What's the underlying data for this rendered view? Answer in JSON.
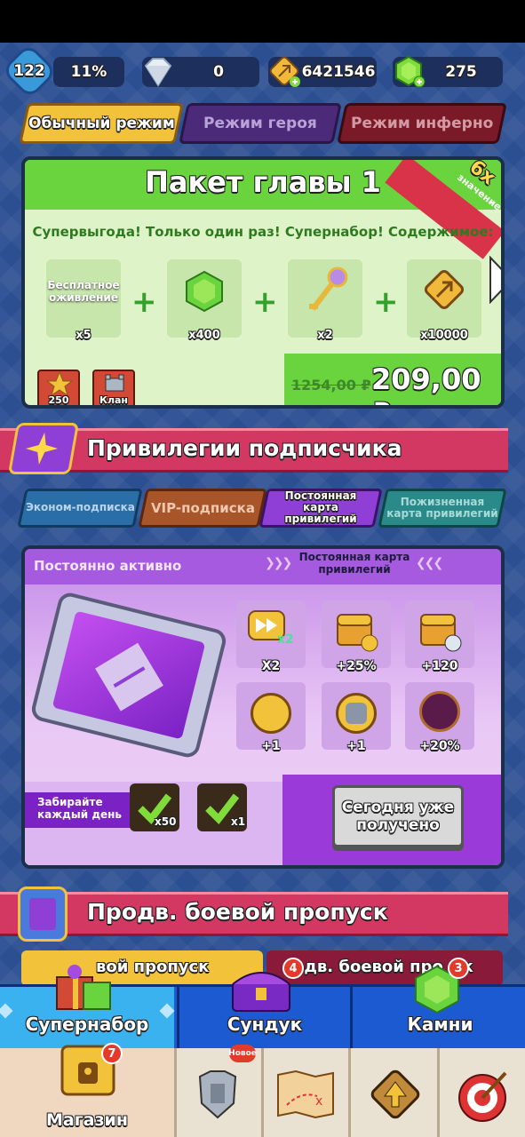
{
  "topbar": {
    "level": "122",
    "percent": "11%",
    "diamonds": "0",
    "coins": "6421546",
    "gems": "275"
  },
  "modes": [
    "Обычный режим",
    "Режим героя",
    "Режим инферно"
  ],
  "pack": {
    "title": "Пакет главы 1",
    "badge_value": "6x",
    "badge_label": "значение",
    "subtitle": "Супервыгода! Только один раз! Супернабор! Содержимое:",
    "items": [
      {
        "label": "Бесплатное оживление",
        "qty": "x5",
        "icon": "revive-text"
      },
      {
        "label": "",
        "qty": "x400",
        "icon": "gem-icon"
      },
      {
        "label": "",
        "qty": "x2",
        "icon": "key-icon"
      },
      {
        "label": "",
        "qty": "x10000",
        "icon": "coin-icon"
      }
    ],
    "old_price": "1254,00 ₽",
    "price": "209,00 ₽",
    "star_count": "250",
    "clan_label": "Клан"
  },
  "privileges": {
    "title": "Привилегии подписчика",
    "tabs": [
      "Эконом-подписка",
      "VIP-подписка",
      "Постоянная карта привилегий",
      "Пожизненная карта привилегий"
    ],
    "active_label": "Постоянно активно",
    "card_title": "Постоянная карта привилегий",
    "perks": [
      {
        "label": "X2",
        "icon": "fast-forward-icon",
        "sub": "x2"
      },
      {
        "label": "+25%",
        "icon": "chest-sword-icon"
      },
      {
        "label": "+120",
        "icon": "chest-timer-icon"
      },
      {
        "label": "+1",
        "icon": "sword-icon"
      },
      {
        "label": "+1",
        "icon": "armor-icon"
      },
      {
        "label": "+20%",
        "icon": "emblem-up-icon"
      }
    ],
    "daily_label": "Забирайте каждый день",
    "daily_rewards": [
      "x50",
      "x1"
    ],
    "claimed_button": "Сегодня уже получено"
  },
  "battlepass": {
    "title": "Продв. боевой пропуск",
    "tabs": [
      "вой пропуск",
      "одв. боевой про",
      "ск"
    ]
  },
  "nav_top": [
    {
      "label": "Супернабор",
      "icon": "gift-icon",
      "badge": ""
    },
    {
      "label": "Сундук",
      "icon": "chest-icon",
      "badge": "4"
    },
    {
      "label": "Камни",
      "icon": "gem-icon",
      "badge": "3"
    }
  ],
  "nav_bottom": [
    {
      "label": "Магазин",
      "icon": "shop-icon",
      "badge": "7"
    },
    {
      "label": "",
      "icon": "armor-icon",
      "badge": "Новое"
    },
    {
      "label": "",
      "icon": "map-icon",
      "badge": ""
    },
    {
      "label": "",
      "icon": "upgrade-icon",
      "badge": ""
    },
    {
      "label": "",
      "icon": "target-icon",
      "badge": ""
    }
  ],
  "colors": {
    "green": "#6ad43e",
    "red_ribbon": "#d33862",
    "purple": "#8f3fd6",
    "nav_blue": "#1b5ad0"
  }
}
